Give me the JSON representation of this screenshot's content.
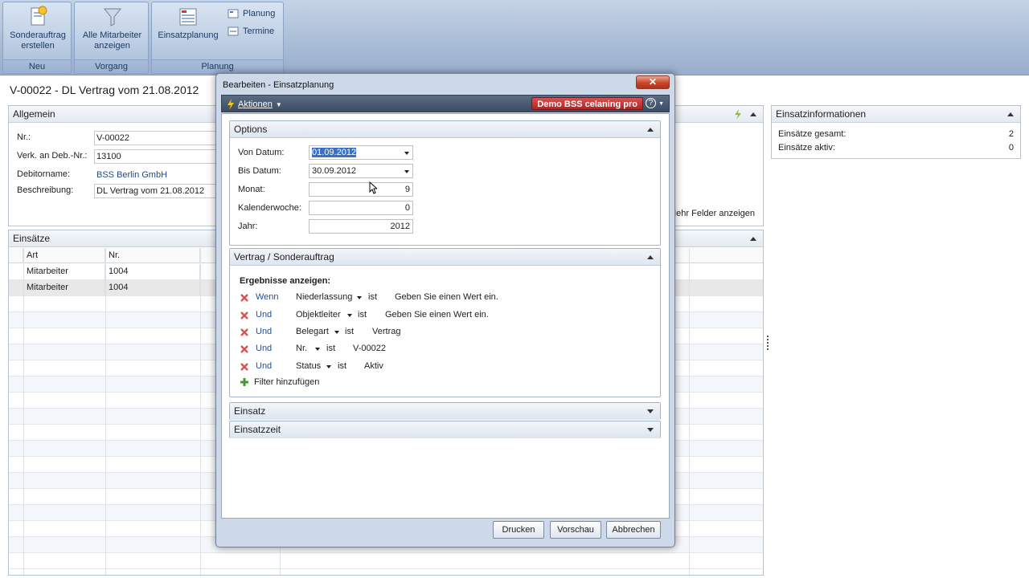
{
  "ribbon": {
    "groups": [
      {
        "label": "Neu",
        "button": "Sonderauftrag erstellen"
      },
      {
        "label": "Vorgang",
        "button": "Alle Mitarbeiter anzeigen"
      },
      {
        "label": "Planung",
        "button": "Einsatzplanung",
        "small": [
          "Planung",
          "Termine"
        ]
      }
    ]
  },
  "page": {
    "title": "V-00022 - DL Vertrag vom 21.08.2012"
  },
  "allgemein": {
    "title": "Allgemein",
    "fields": [
      {
        "label": "Nr.:",
        "value": "V-00022"
      },
      {
        "label": "Verk. an Deb.-Nr.:",
        "value": "13100"
      },
      {
        "label": "Debitorname:",
        "value": "BSS Berlin GmbH"
      },
      {
        "label": "Beschreibung:",
        "value": "DL Vertrag vom 21.08.2012"
      }
    ],
    "more_fields": "Mehr Felder anzeigen"
  },
  "einsaetze": {
    "title": "Einsätze",
    "columns": [
      "Art",
      "Nr."
    ],
    "rows": [
      {
        "art": "Mitarbeiter",
        "nr": "1004"
      },
      {
        "art": "Mitarbeiter",
        "nr": "1004"
      }
    ]
  },
  "einsatzinfo": {
    "title": "Einsatzinformationen",
    "rows": [
      {
        "label": "Einsätze gesamt:",
        "value": "2"
      },
      {
        "label": "Einsätze aktiv:",
        "value": "0"
      }
    ]
  },
  "modal": {
    "title": "Bearbeiten - Einsatzplanung",
    "actions": "Aktionen",
    "demo": "Demo BSS celaning pro",
    "options": {
      "title": "Options",
      "von_label": "Von Datum:",
      "von_value": "01.09.2012",
      "bis_label": "Bis Datum:",
      "bis_value": "30.09.2012",
      "monat_label": "Monat:",
      "monat_value": "9",
      "kw_label": "Kalenderwoche:",
      "kw_value": "0",
      "jahr_label": "Jahr:",
      "jahr_value": "2012"
    },
    "vertrag": {
      "title": "Vertrag / Sonderauftrag",
      "results_label": "Ergebnisse anzeigen:",
      "filters": [
        {
          "conj": "Wenn",
          "field": "Niederlassung",
          "op": "ist",
          "value": "Geben Sie einen Wert ein."
        },
        {
          "conj": "Und",
          "field": "Objektleiter",
          "op": "ist",
          "value": "Geben Sie einen Wert ein."
        },
        {
          "conj": "Und",
          "field": "Belegart",
          "op": "ist",
          "value": "Vertrag"
        },
        {
          "conj": "Und",
          "field": "Nr.",
          "op": "ist",
          "value": "V-00022"
        },
        {
          "conj": "Und",
          "field": "Status",
          "op": "ist",
          "value": "Aktiv"
        }
      ],
      "add_filter": "Filter hinzufügen"
    },
    "einsatz": {
      "title": "Einsatz"
    },
    "einsatzzeit": {
      "title": "Einsatzzeit"
    },
    "buttons": {
      "print": "Drucken",
      "preview": "Vorschau",
      "cancel": "Abbrechen"
    }
  }
}
